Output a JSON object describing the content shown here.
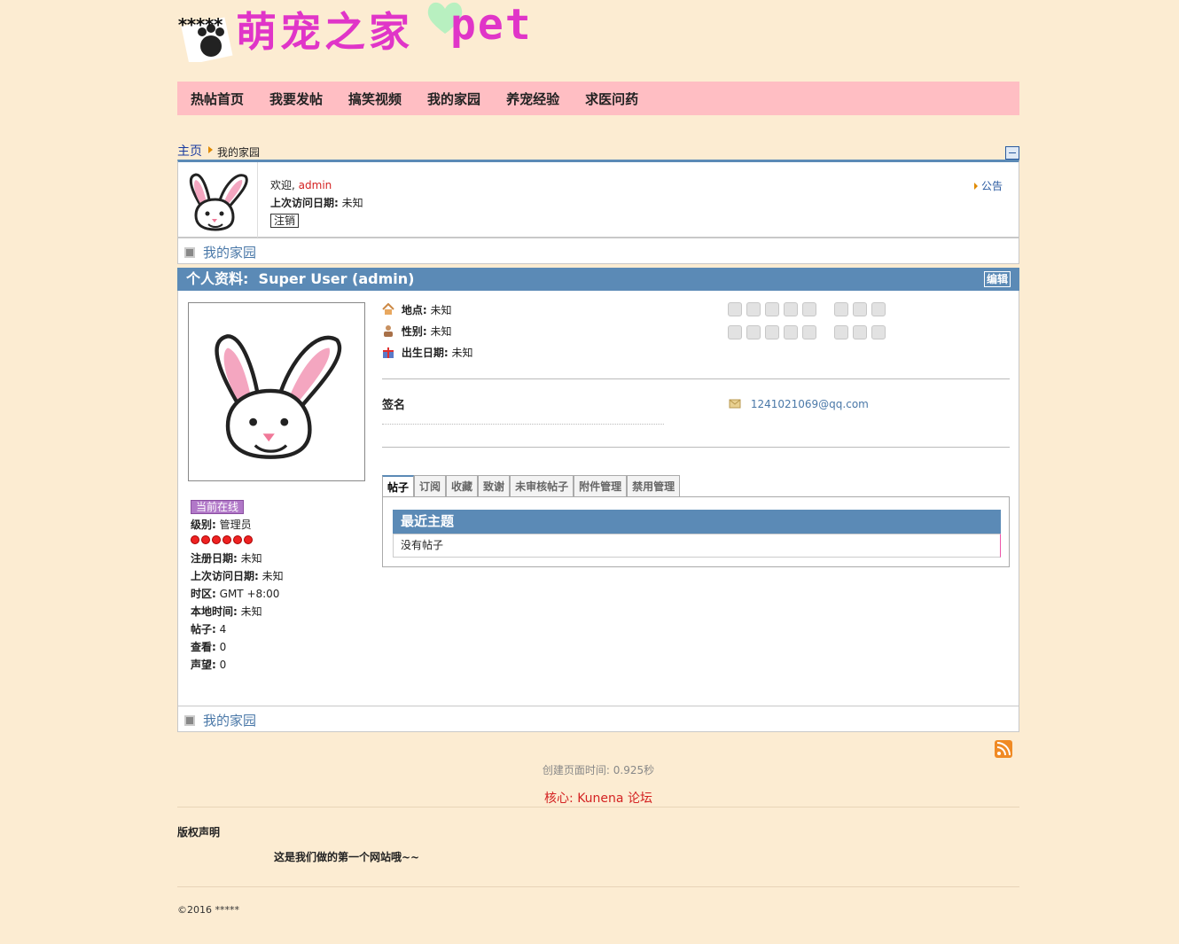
{
  "logo": {
    "stars": "*****",
    "cn_text": "萌宠之家",
    "en_text": "pet"
  },
  "nav": [
    "热帖首页",
    "我要发帖",
    "搞笑视频",
    "我的家园",
    "养宠经验",
    "求医问药"
  ],
  "breadcrumb": {
    "home": "主页",
    "current": "我的家园"
  },
  "userbox": {
    "welcome": "欢迎,",
    "username": "admin",
    "last_visit_label": "上次访问日期:",
    "last_visit_value": "未知",
    "logout": "注销",
    "notice": "公告"
  },
  "home_link": "我的家园",
  "profile": {
    "header_label": "个人资料:",
    "header_name": "Super User (admin)",
    "edit": "编辑",
    "online": "当前在线",
    "rank_label": "级别:",
    "rank_value": "管理员",
    "register_label": "注册日期:",
    "register_value": "未知",
    "last_visit_label": "上次访问日期:",
    "last_visit_value": "未知",
    "tz_label": "时区:",
    "tz_value": "GMT +8:00",
    "local_time_label": "本地时间:",
    "local_time_value": "未知",
    "posts_label": "帖子:",
    "posts_value": "4",
    "views_label": "查看:",
    "views_value": "0",
    "karma_label": "声望:",
    "karma_value": "0",
    "location_label": "地点:",
    "location_value": "未知",
    "gender_label": "性别:",
    "gender_value": "未知",
    "birthdate_label": "出生日期:",
    "birthdate_value": "未知",
    "signature_label": "签名",
    "email": "1241021069@qq.com"
  },
  "tabs": [
    "帖子",
    "订阅",
    "收藏",
    "致谢",
    "未审核帖子",
    "附件管理",
    "禁用管理"
  ],
  "recent": {
    "title": "最近主题",
    "empty": "没有帖子"
  },
  "gen_time": "创建页面时间: 0.925秒",
  "core": "核心: Kunena 论坛",
  "copyright": {
    "title": "版权声明",
    "text": "这是我们做的第一个网站哦~~"
  },
  "footer": "©2016 *****",
  "colors": {
    "background": "#fcecd2",
    "nav": "#ffbec3",
    "accent_blue": "#5b8ab6",
    "logo_pink": "#e035c8",
    "link_red": "#d42222"
  }
}
